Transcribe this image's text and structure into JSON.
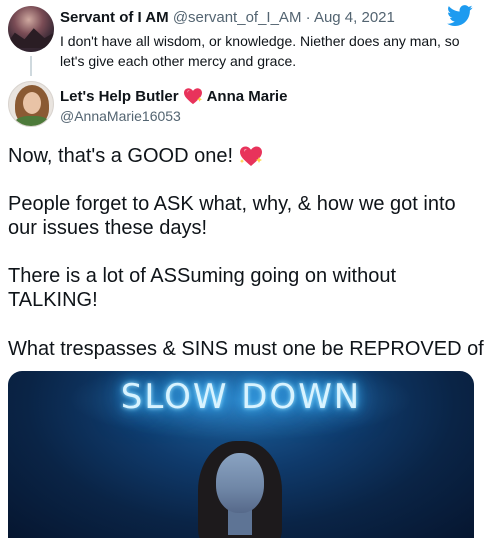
{
  "quoted_tweet": {
    "display_name": "Servant of I AM",
    "handle": "@servant_of_I_AM",
    "separator": "·",
    "date": "Aug 4, 2021",
    "text": "I don't have all wisdom, or knowledge. Niether does any man, so let's give each other mercy and grace.",
    "bird_icon": "twitter-bird-icon",
    "brand_color": "#1d9bf0"
  },
  "author": {
    "name_part1": "Let's Help Butler",
    "name_part2": "Anna Marie",
    "handle": "@AnnaMarie16053",
    "name_emoji": "sparkling-heart-icon"
  },
  "tweet": {
    "line1": "Now, that's a GOOD one!",
    "line1_emoji": "sparkling-heart-icon",
    "paragraph2": "People forget to ASK what, why, & how we got into our issues these days!",
    "paragraph3": "There is a lot of ASSuming going on without TALKING!",
    "paragraph4": "What trespasses & SINS must one be REPROVED of?"
  },
  "media": {
    "neon_text": "SLOW DOWN",
    "neon_color": "#4fc3ff"
  }
}
